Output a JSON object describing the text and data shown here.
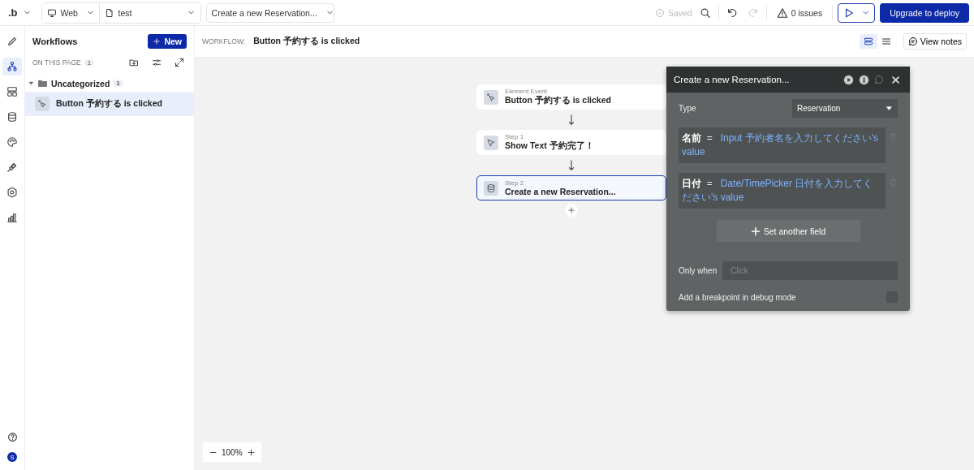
{
  "topbar": {
    "logo": ".b",
    "platform": "Web",
    "page": "test",
    "workflow_select": "Create a new Reservation...",
    "saved": "Saved",
    "issues": "0 issues",
    "deploy": "Upgrade to deploy"
  },
  "rail": {
    "items": [
      {
        "kind": "design",
        "selected": false
      },
      {
        "kind": "workflow",
        "selected": true
      },
      {
        "kind": "elements",
        "selected": false
      },
      {
        "kind": "data",
        "selected": false
      },
      {
        "kind": "styles",
        "selected": false
      },
      {
        "kind": "plugins",
        "selected": false
      },
      {
        "kind": "settings",
        "selected": false
      },
      {
        "kind": "logs",
        "selected": false
      }
    ],
    "avatar": "S"
  },
  "sidebar": {
    "title": "Workflows",
    "new_button": "New",
    "section": "ON THIS PAGE",
    "section_count": "1",
    "folders": [
      {
        "name": "Uncategorized",
        "count": "1",
        "expanded": true,
        "children": [
          {
            "label": "Button 予約する is clicked",
            "selected": true
          }
        ]
      }
    ]
  },
  "header": {
    "label": "WORKFLOW:",
    "title": "Button 予約する is clicked",
    "notes": "View notes"
  },
  "steps": [
    {
      "kind": "event",
      "caption": "Element Event",
      "title": "Button 予約する is clicked",
      "selected": false
    },
    {
      "kind": "show",
      "caption": "Step 1",
      "title": "Show Text 予約完了！",
      "selected": false
    },
    {
      "kind": "data",
      "caption": "Step 2",
      "title": "Create a new Reservation...",
      "selected": true
    }
  ],
  "panel": {
    "title": "Create a new Reservation...",
    "type_label": "Type",
    "type_value": "Reservation",
    "fields": [
      {
        "name": "名前",
        "op": "=",
        "value": "Input 予約者名を入力してください's value"
      },
      {
        "name": "日付",
        "op": "=",
        "value": "Date/TimePicker 日付を入力してください's value"
      }
    ],
    "add_field": "Set another field",
    "only_when_label": "Only when",
    "only_when": {
      "placeholder": "Click"
    },
    "breakpoint_label": "Add a breakpoint in debug mode",
    "breakpoint": {
      "checked": false
    }
  },
  "zoom": "100%"
}
